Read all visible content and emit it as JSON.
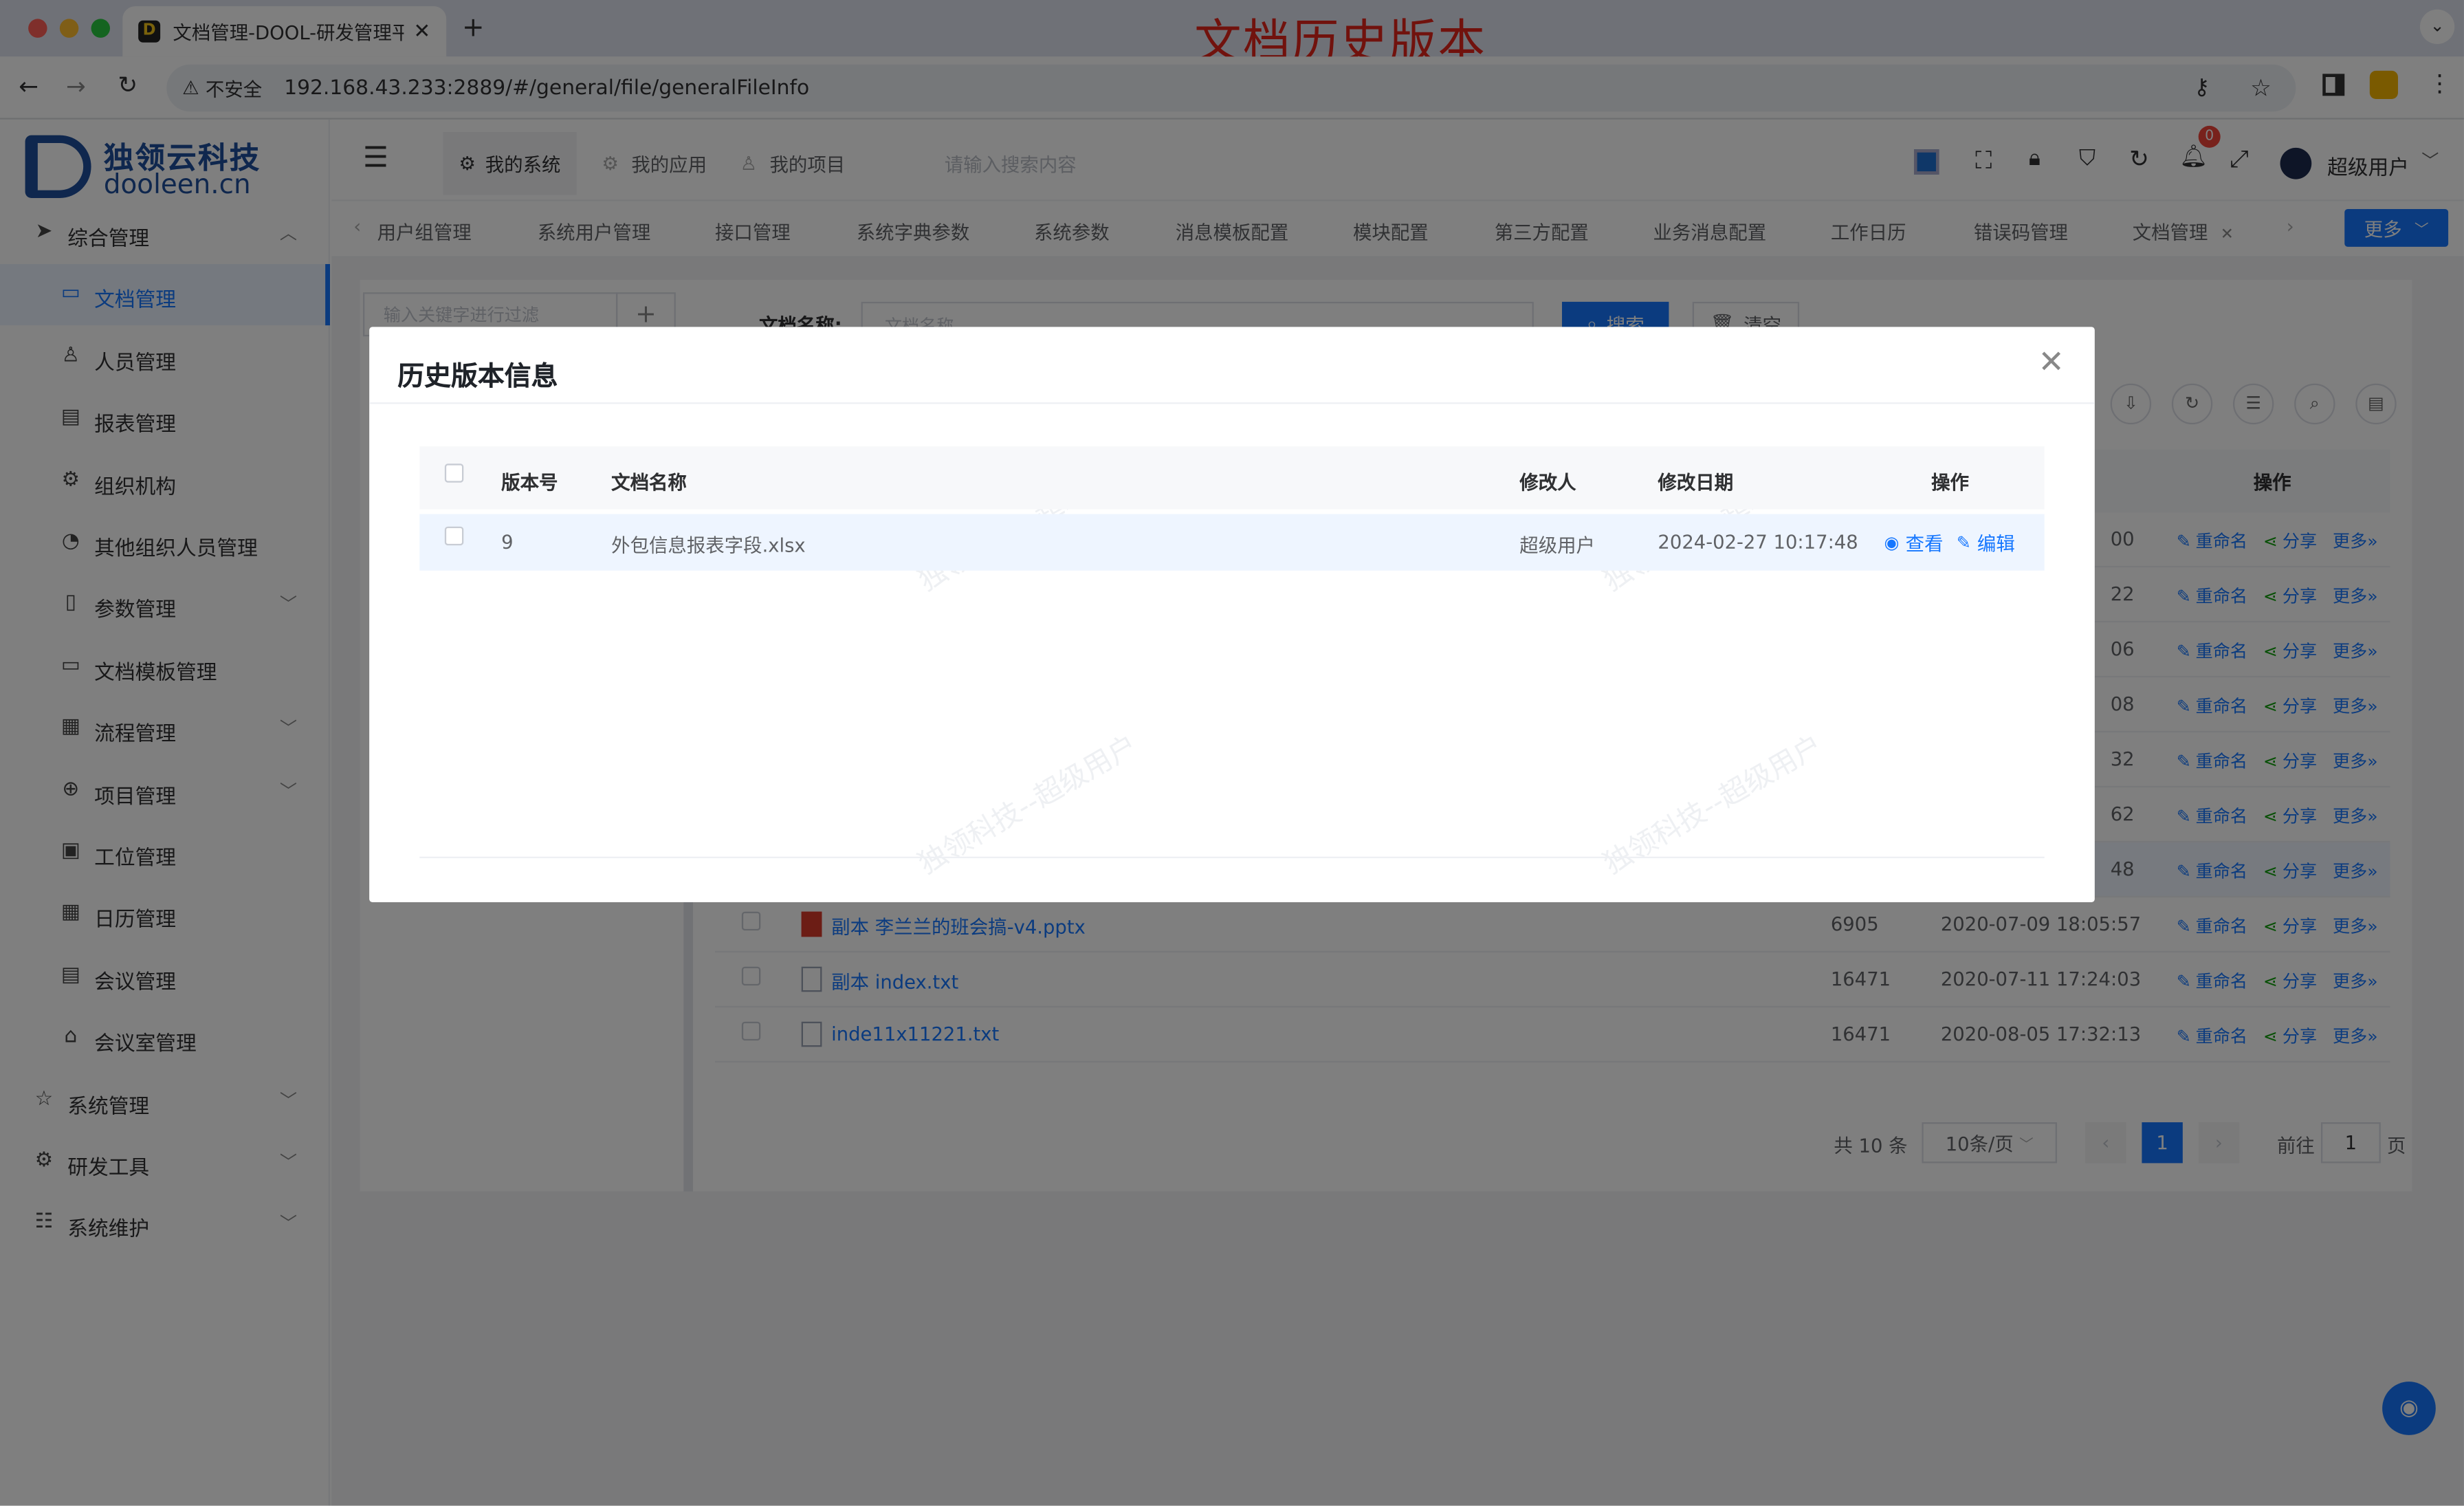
{
  "browser": {
    "tab_title": "文档管理-DOOL-研发管理平台",
    "annotation": "文档历史版本",
    "insecure_label": "不安全",
    "url": "192.168.43.233:2889/#/general/file/generalFileInfo"
  },
  "logo": {
    "name_cn": "独领云科技",
    "name_en": "dooleen.cn"
  },
  "sidebar": {
    "items": [
      {
        "label": "综合管理",
        "icon": "send-icon",
        "arrow": "︿"
      },
      {
        "label": "文档管理",
        "icon": "folder-icon"
      },
      {
        "label": "人员管理",
        "icon": "user-icon"
      },
      {
        "label": "报表管理",
        "icon": "report-icon"
      },
      {
        "label": "组织机构",
        "icon": "gear-icon"
      },
      {
        "label": "其他组织人员管理",
        "icon": "gauge-icon"
      },
      {
        "label": "参数管理",
        "icon": "book-icon",
        "arrow": "﹀"
      },
      {
        "label": "文档模板管理",
        "icon": "template-icon"
      },
      {
        "label": "流程管理",
        "icon": "calendar-icon",
        "arrow": "﹀"
      },
      {
        "label": "项目管理",
        "icon": "plus-circle-icon",
        "arrow": "﹀"
      },
      {
        "label": "工位管理",
        "icon": "clipboard-icon"
      },
      {
        "label": "日历管理",
        "icon": "calendar-icon"
      },
      {
        "label": "会议管理",
        "icon": "doc-icon"
      },
      {
        "label": "会议室管理",
        "icon": "home-icon"
      },
      {
        "label": "系统管理",
        "icon": "star-icon",
        "arrow": "﹀"
      },
      {
        "label": "研发工具",
        "icon": "settings-icon",
        "arrow": "﹀"
      },
      {
        "label": "系统维护",
        "icon": "sliders-icon",
        "arrow": "﹀"
      }
    ]
  },
  "topnav": {
    "tabs": [
      "我的系统",
      "我的应用",
      "我的项目"
    ],
    "search_placeholder": "请输入搜索内容",
    "badge": "0",
    "user": "超级用户"
  },
  "tags": {
    "items": [
      "用户组管理",
      "系统用户管理",
      "接口管理",
      "系统字典参数",
      "系统参数",
      "消息模板配置",
      "模块配置",
      "第三方配置",
      "业务消息配置",
      "工作日历",
      "错误码管理",
      "文档管理"
    ],
    "more": "更多"
  },
  "filter": {
    "tree_placeholder": "输入关键字进行过滤",
    "doc_name_label": "文档名称:",
    "doc_name_placeholder": "文档名称",
    "search_btn": "搜索",
    "clear_btn": "清空"
  },
  "table": {
    "op_header": "操作",
    "rename": "重命名",
    "share": "分享",
    "more": "更多",
    "hidden_rows": [
      {
        "size_tail": "00"
      },
      {
        "size_tail": "22"
      },
      {
        "size_tail": "06"
      },
      {
        "size_tail": "08"
      },
      {
        "size_tail": "32"
      },
      {
        "size_tail": "62"
      },
      {
        "size_tail": "48"
      }
    ],
    "rows": [
      {
        "name": "副本 李兰兰的班会搞-v4.pptx",
        "size": "6905",
        "date": "2020-07-09 18:05:57"
      },
      {
        "name": "副本 index.txt",
        "size": "16471",
        "date": "2020-07-11 17:24:03"
      },
      {
        "name": "inde11x11221.txt",
        "size": "16471",
        "date": "2020-08-05 17:32:13"
      }
    ]
  },
  "pagination": {
    "total": "共 10 条",
    "page_size": "10条/页",
    "current": "1",
    "goto": "前往",
    "goto_value": "1",
    "page_unit": "页"
  },
  "dialog": {
    "title": "历史版本信息",
    "headers": {
      "version": "版本号",
      "name": "文档名称",
      "modifier": "修改人",
      "date": "修改日期",
      "ops": "操作"
    },
    "row": {
      "version": "9",
      "name": "外包信息报表字段.xlsx",
      "modifier": "超级用户",
      "date": "2024-02-27 10:17:48",
      "view": "查看",
      "edit": "编辑"
    },
    "watermark": "独领科技--超级用户"
  }
}
